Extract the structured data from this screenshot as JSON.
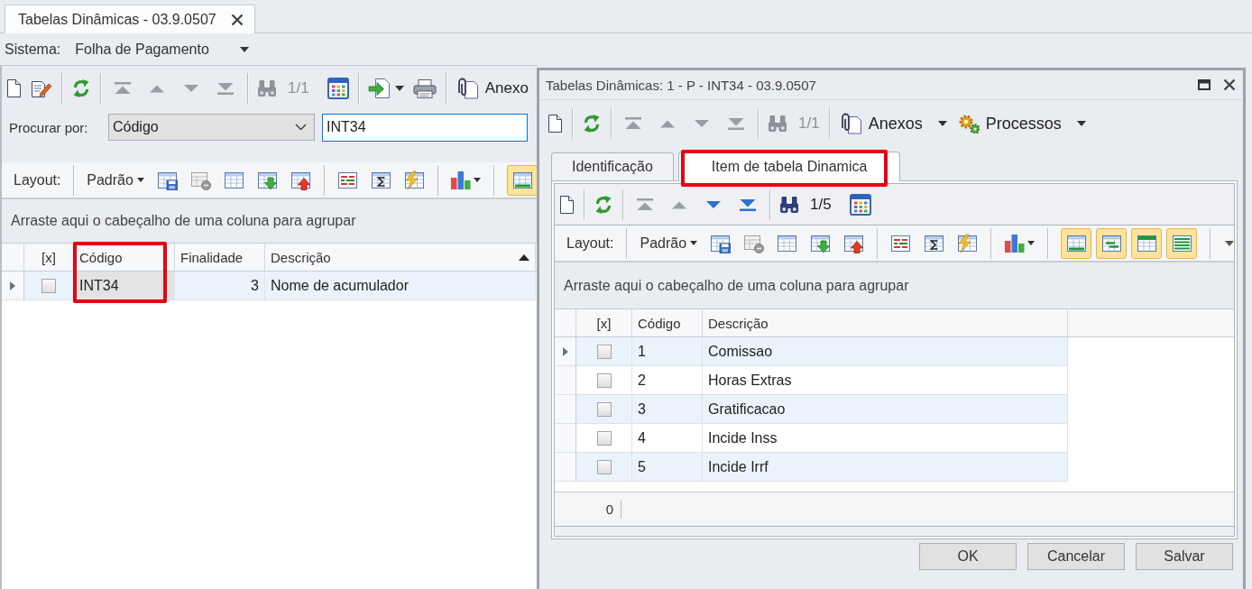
{
  "main": {
    "tab": {
      "title": "Tabelas Dinâmicas - 03.9.0507",
      "selected": true
    },
    "system": {
      "label": "Sistema:",
      "value": "Folha de Pagamento"
    },
    "toolbar": {
      "navigation": [
        {
          "disabled": true
        },
        {
          "disabled": true
        },
        {
          "disabled": true
        },
        {
          "disabled": true
        }
      ],
      "record_counter": {
        "text": "1/1",
        "disabled": true
      },
      "attachments": {
        "label": "Anexo"
      }
    },
    "search": {
      "label": "Procurar por:",
      "field": "Código",
      "value": "INT34"
    },
    "layout_bar": {
      "label": "Layout:",
      "preset": "Padrão",
      "view_toggles": [
        {
          "on": true
        }
      ]
    },
    "grid": {
      "group_hint": "Arraste aqui o cabeçalho de uma coluna para agrupar",
      "check_header": "[x]",
      "columns": [
        {
          "label": "Código",
          "kind": "text",
          "sorted": false,
          "highlighted": true,
          "focused": true
        },
        {
          "label": "Finalidade",
          "kind": "number",
          "sorted": false,
          "highlighted": false,
          "focused": false
        },
        {
          "label": "Descrição",
          "kind": "text",
          "sorted": true,
          "highlighted": false,
          "focused": false
        }
      ],
      "rows": [
        {
          "selected": true,
          "checked": false,
          "cells": [
            "INT34",
            "3",
            "Nome de acumulador"
          ]
        }
      ]
    }
  },
  "dialog": {
    "title": "Tabelas Dinâmicas: 1 - P - INT34 - 03.9.0507",
    "toolbar": {
      "navigation": [
        {
          "disabled": true
        },
        {
          "disabled": true
        },
        {
          "disabled": true
        },
        {
          "disabled": true
        }
      ],
      "record_counter": {
        "text": "1/1",
        "disabled": true
      },
      "attachments": {
        "label": "Anexos"
      },
      "processes": {
        "label": "Processos"
      }
    },
    "tabs": [
      {
        "label": "Identificação",
        "selected": false,
        "highlighted": false
      },
      {
        "label": "Item de tabela Dinamica",
        "selected": true,
        "highlighted": true
      }
    ],
    "inner_toolbar": {
      "navigation": [
        {
          "disabled": true
        },
        {
          "disabled": true
        },
        {
          "disabled": false
        },
        {
          "disabled": false
        }
      ],
      "record_counter": {
        "text": "1/5",
        "disabled": false
      }
    },
    "layout_bar": {
      "label": "Layout:",
      "preset": "Padrão",
      "view_toggles": [
        {
          "on": true
        },
        {
          "on": true
        },
        {
          "on": true
        },
        {
          "on": true
        }
      ]
    },
    "grid": {
      "group_hint": "Arraste aqui o cabeçalho de uma coluna para agrupar",
      "check_header": "[x]",
      "columns": [
        {
          "label": "Código",
          "sorted": false,
          "highlighted": false,
          "focused": false
        },
        {
          "label": "Descrição",
          "sorted": false,
          "highlighted": false,
          "focused": false
        }
      ],
      "rows": [
        {
          "selected": true,
          "checked": false,
          "cells": [
            "1",
            "Comissao"
          ]
        },
        {
          "selected": false,
          "checked": false,
          "cells": [
            "2",
            "Horas Extras"
          ]
        },
        {
          "selected": false,
          "checked": false,
          "cells": [
            "3",
            "Gratificacao"
          ]
        },
        {
          "selected": false,
          "checked": false,
          "cells": [
            "4",
            "Incide Inss"
          ]
        },
        {
          "selected": false,
          "checked": false,
          "cells": [
            "5",
            "Incide Irrf"
          ]
        }
      ],
      "footer": "0"
    },
    "buttons": [
      "OK",
      "Cancelar",
      "Salvar"
    ]
  }
}
